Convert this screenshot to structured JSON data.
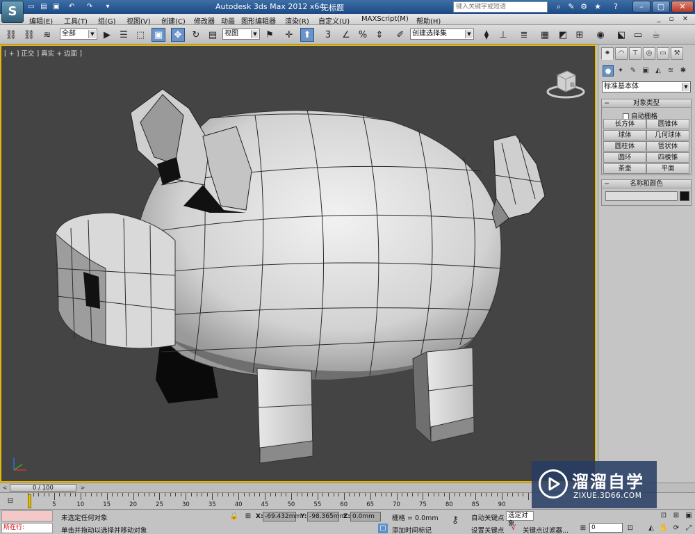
{
  "titlebar": {
    "app_title": "Autodesk 3ds Max  2012 x64",
    "file_name": "无标题",
    "search_placeholder": "键入关键字或短语"
  },
  "menus": [
    "编辑(E)",
    "工具(T)",
    "组(G)",
    "视图(V)",
    "创建(C)",
    "修改器",
    "动画",
    "图形编辑器",
    "渲染(R)",
    "自定义(U)",
    "MAXScript(M)",
    "帮助(H)"
  ],
  "toolbar": {
    "selection_filter": "全部",
    "reference_coord": "视图",
    "named_selection": "创建选择集"
  },
  "viewport": {
    "label": "[ + ] 正交 ] 真实 + 边面 ]",
    "viewcube_face": "前"
  },
  "command_panel": {
    "category": "标准基本体",
    "object_type_title": "对象类型",
    "auto_grid": "自动栅格",
    "primitives": [
      "长方体",
      "圆锥体",
      "球体",
      "几何球体",
      "圆柱体",
      "管状体",
      "圆环",
      "四棱锥",
      "茶壶",
      "平面"
    ],
    "name_color_title": "名称和颜色",
    "color": "#111111"
  },
  "timeline": {
    "frame_display": "0 / 100",
    "ticks": [
      5,
      10,
      15,
      20,
      25,
      30,
      35,
      40,
      45,
      50,
      55,
      60,
      65,
      70,
      75,
      80,
      85,
      90
    ],
    "current_frame": 0
  },
  "statusbar": {
    "listener_label": "所在行:",
    "selection_status": "未选定任何对象",
    "prompt": "单击并拖动以选择并移动对象",
    "x_label": "X:",
    "x_value": "-69.432mm",
    "y_label": "Y:",
    "y_value": "-98.365mm",
    "z_label": "Z:",
    "z_value": "0.0mm",
    "grid": "栅格 = 0.0mm",
    "add_time_tag": "添加时间标记",
    "auto_key": "自动关键点",
    "set_key": "设置关键点",
    "selected": "选定对象",
    "key_filters": "关键点过滤器...",
    "frame_value": "0"
  },
  "watermark": {
    "title": "溜溜自学",
    "url": "ZIXUE.3D66.COM"
  },
  "colors": {
    "viewport_bg": "#444444",
    "viewport_border": "#e6b800",
    "active_tool": "#6a94c8"
  }
}
